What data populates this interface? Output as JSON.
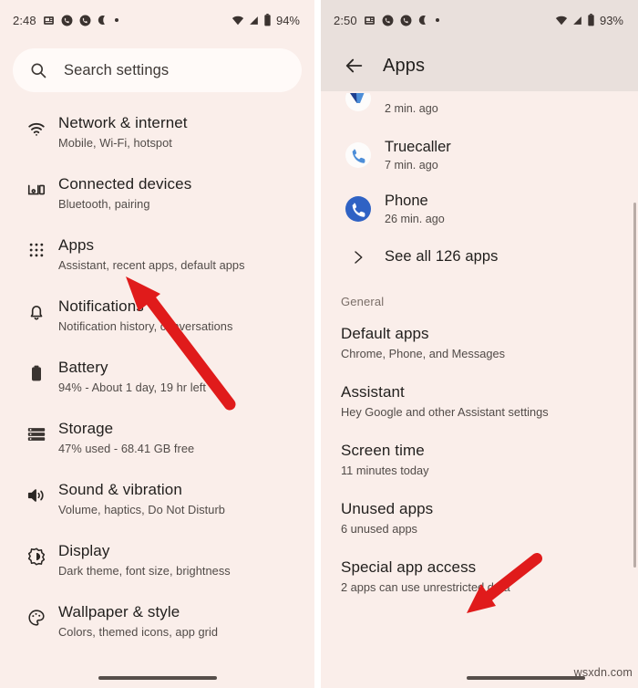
{
  "left_phone": {
    "status_bar": {
      "time": "2:48",
      "battery_percent": "94%",
      "icons": [
        "news-icon",
        "call-icon",
        "call-icon",
        "moon-icon",
        "dot-icon",
        "wifi-icon",
        "signal-icon",
        "battery-icon"
      ]
    },
    "search": {
      "placeholder": "Search settings",
      "icon": "search-icon"
    },
    "items": [
      {
        "icon": "wifi-icon",
        "title": "Network & internet",
        "subtitle": "Mobile, Wi-Fi, hotspot"
      },
      {
        "icon": "connected-devices-icon",
        "title": "Connected devices",
        "subtitle": "Bluetooth, pairing"
      },
      {
        "icon": "apps-grid-icon",
        "title": "Apps",
        "subtitle": "Assistant, recent apps, default apps"
      },
      {
        "icon": "bell-icon",
        "title": "Notifications",
        "subtitle": "Notification history, conversations"
      },
      {
        "icon": "battery-icon",
        "title": "Battery",
        "subtitle": "94% - About 1 day, 19 hr left"
      },
      {
        "icon": "storage-icon",
        "title": "Storage",
        "subtitle": "47% used - 68.41 GB free"
      },
      {
        "icon": "sound-icon",
        "title": "Sound & vibration",
        "subtitle": "Volume, haptics, Do Not Disturb"
      },
      {
        "icon": "brightness-icon",
        "title": "Display",
        "subtitle": "Dark theme, font size, brightness"
      },
      {
        "icon": "palette-icon",
        "title": "Wallpaper & style",
        "subtitle": "Colors, themed icons, app grid"
      }
    ]
  },
  "right_phone": {
    "status_bar": {
      "time": "2:50",
      "battery_percent": "93%"
    },
    "app_bar": {
      "back_icon": "back-arrow-icon",
      "title": "Apps"
    },
    "recent_apps": [
      {
        "icon": "app-logo-cut-icon",
        "name": "",
        "time": "2 min. ago"
      },
      {
        "icon": "truecaller-icon",
        "name": "Truecaller",
        "time": "7 min. ago"
      },
      {
        "icon": "phone-app-icon",
        "name": "Phone",
        "time": "26 min. ago"
      }
    ],
    "see_all": {
      "label": "See all 126 apps",
      "icon": "chevron-right-icon"
    },
    "section_title": "General",
    "general_items": [
      {
        "title": "Default apps",
        "subtitle": "Chrome, Phone, and Messages"
      },
      {
        "title": "Assistant",
        "subtitle": "Hey Google and other Assistant settings"
      },
      {
        "title": "Screen time",
        "subtitle": "11 minutes today"
      },
      {
        "title": "Unused apps",
        "subtitle": "6 unused apps"
      },
      {
        "title": "Special app access",
        "subtitle": "2 apps can use unrestricted data"
      }
    ]
  },
  "annotations": {
    "arrow_color": "#e01b1b",
    "left_arrow_target": "Apps",
    "right_arrow_target": "Special app access"
  },
  "watermark": "wsxdn.com"
}
